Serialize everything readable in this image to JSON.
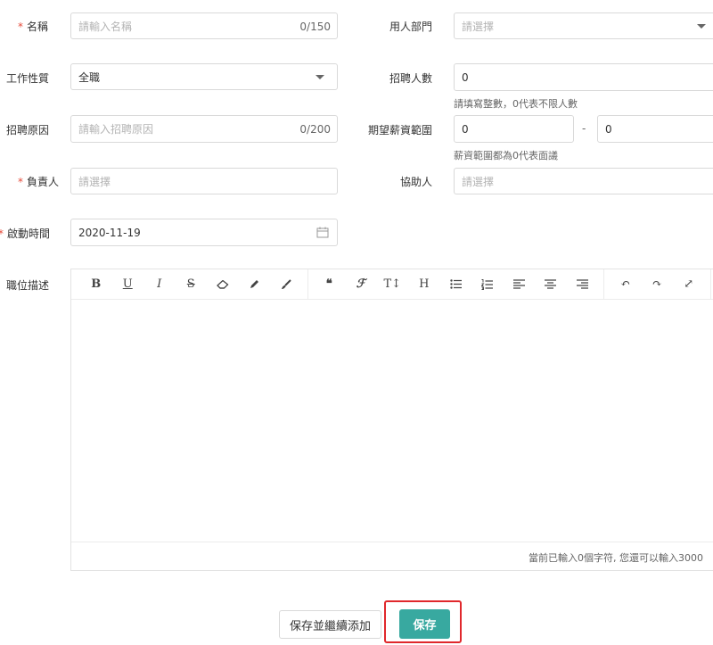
{
  "form": {
    "name": {
      "label": "名稱",
      "required_mark": "*",
      "placeholder": "請輸入名稱",
      "counter": "0/150"
    },
    "department": {
      "label": "用人部門",
      "placeholder": "請選擇"
    },
    "job_type": {
      "label": "工作性質",
      "value": "全職"
    },
    "headcount": {
      "label": "招聘人數",
      "value": "0",
      "hint": "請填寫整數，0代表不限人數"
    },
    "reason": {
      "label": "招聘原因",
      "placeholder": "請輸入招聘原因",
      "counter": "0/200"
    },
    "salary": {
      "label": "期望薪資範圍",
      "min": "0",
      "dash": "-",
      "max": "0",
      "hint": "薪資範圍都為0代表面議"
    },
    "owner": {
      "label": "負責人",
      "required_mark": "*",
      "placeholder": "請選擇"
    },
    "assistant": {
      "label": "協助人",
      "placeholder": "請選擇"
    },
    "start_date": {
      "label": "啟動時間",
      "required_mark": "*",
      "value": "2020-11-19"
    },
    "description": {
      "label": "職位描述",
      "counter_text": "當前已輸入0個字符, 您還可以輸入3000"
    }
  },
  "toolbar": {
    "bold": "B",
    "underline": "U",
    "italic": "I",
    "strike": "S",
    "quote": "❝",
    "font": "ℱ",
    "text_size": "T↕",
    "heading": "H",
    "undo": "↶",
    "redo": "↷",
    "fullscreen": "⤢"
  },
  "buttons": {
    "save_continue": "保存並繼續添加",
    "save": "保存"
  }
}
